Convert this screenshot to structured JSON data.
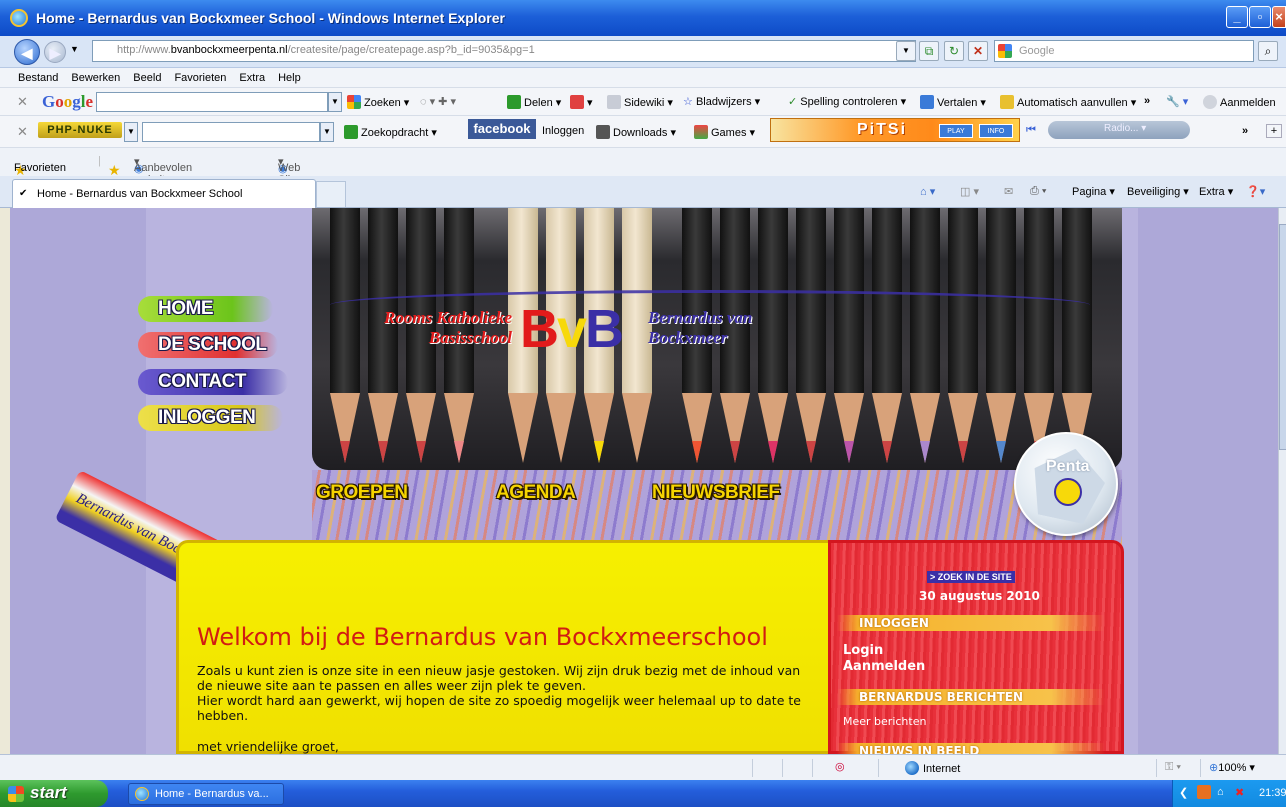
{
  "window": {
    "title": "Home - Bernardus van Bockxmeer School - Windows Internet Explorer"
  },
  "address": {
    "url_prefix": "http://www.",
    "url_host": "bvanbockxmeerpenta.nl",
    "url_path": "/createsite/page/createpage.asp?b_id=9035&pg=1",
    "search_placeholder": "Google"
  },
  "menu": [
    "Bestand",
    "Bewerken",
    "Beeld",
    "Favorieten",
    "Extra",
    "Help"
  ],
  "google_toolbar": {
    "logo": "Google",
    "items": [
      "Zoeken",
      "Delen",
      "Sidewiki",
      "Bladwijzers",
      "Spelling controleren",
      "Vertalen",
      "Automatisch aanvullen",
      "Aanmelden"
    ]
  },
  "php_toolbar": {
    "logo": "PHP-NUKE",
    "items": [
      "Zoekopdracht",
      "facebook",
      "Inloggen",
      "Downloads",
      "Games"
    ],
    "pitsi": "PiTSi",
    "play": "PLAY",
    "info": "INFO",
    "radio": "Radio..."
  },
  "favorites": {
    "label": "Favorieten",
    "links": [
      "Aanbevolen websites",
      "Web Slice-galerie"
    ]
  },
  "tab": {
    "title": "Home - Bernardus van Bockxmeer School"
  },
  "commandbar": [
    "Pagina",
    "Beveiliging",
    "Extra"
  ],
  "site": {
    "logo_left": [
      "Rooms Katholieke",
      "Basisschool"
    ],
    "logo_right": [
      "Bernardus van",
      "Bockxmeer"
    ],
    "pencil_label": "Bernardus van Bockxmeerschool",
    "penta_label": "Penta",
    "nav": [
      "HOME",
      "DE SCHOOL",
      "CONTACT",
      "INLOGGEN"
    ],
    "subnav": [
      "GROEPEN",
      "AGENDA",
      "NIEUWSBRIEF"
    ],
    "welcome_title": "Welkom bij de Bernardus van Bockxmeerschool",
    "welcome_p1": "Zoals u kunt zien is onze site in een nieuw jasje gestoken. Wij zijn druk bezig met de inhoud van de nieuwe site aan te passen en alles weer zijn plek te geven.",
    "welcome_p2": "Hier wordt hard aan gewerkt, wij hopen de site zo spoedig mogelijk weer helemaal up to date te hebben.",
    "welcome_p3": "met vriendelijke groet,",
    "sidebar": {
      "search": "> ZOEK IN DE SITE",
      "date": "30 augustus 2010",
      "login_head": "INLOGGEN",
      "login": "Login",
      "register": "Aanmelden",
      "news_head": "BERNARDUS BERICHTEN",
      "more": "Meer berichten",
      "images_head": "NIEUWS IN BEELD"
    }
  },
  "status": {
    "zone": "Internet",
    "zoom": "100%"
  },
  "taskbar": {
    "start": "start",
    "item": "Home - Bernardus va...",
    "clock": "21:39"
  }
}
